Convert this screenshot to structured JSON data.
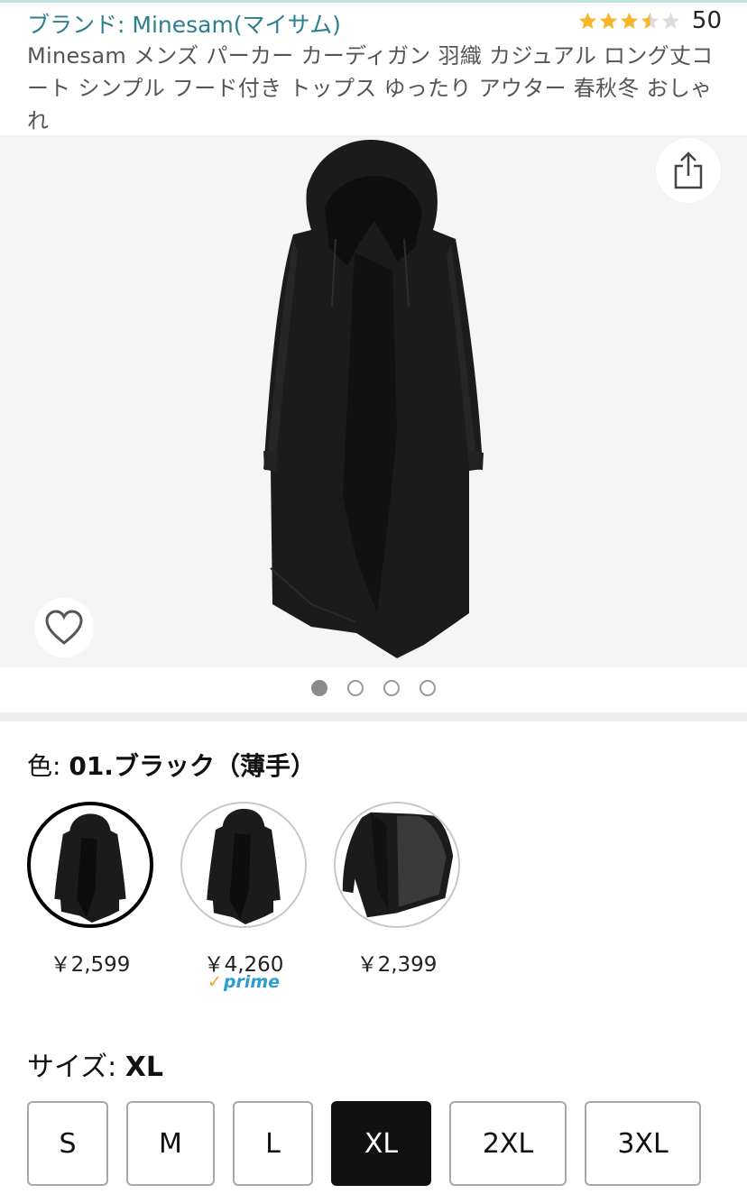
{
  "header": {
    "brand": "ブランド: Minesam(マイサム)",
    "rating_value": 3.5,
    "rating_count": "50"
  },
  "product": {
    "title": "Minesam メンズ パーカー カーディガン 羽織 カジュアル ロング丈コート シンプル フード付き トップス ゆったり アウター 春秋冬 おしゃれ"
  },
  "gallery": {
    "image_count": 4,
    "active_index": 0,
    "icons": {
      "share": "share-icon",
      "favorite": "heart-icon"
    }
  },
  "color": {
    "key": "色: ",
    "selected": "01.ブラック（薄手）",
    "options": [
      {
        "price": "￥2,599",
        "prime": ""
      },
      {
        "price": "￥4,260",
        "prime": "prime"
      },
      {
        "price": "￥2,399",
        "prime": ""
      }
    ]
  },
  "size": {
    "key": "サイズ: ",
    "selected": "XL",
    "options": [
      "S",
      "M",
      "L",
      "XL",
      "2XL",
      "3XL"
    ]
  },
  "colors": {
    "brand_link": "#2d7f8c",
    "star": "#f5b62a",
    "prime": "#2b9dd6"
  }
}
